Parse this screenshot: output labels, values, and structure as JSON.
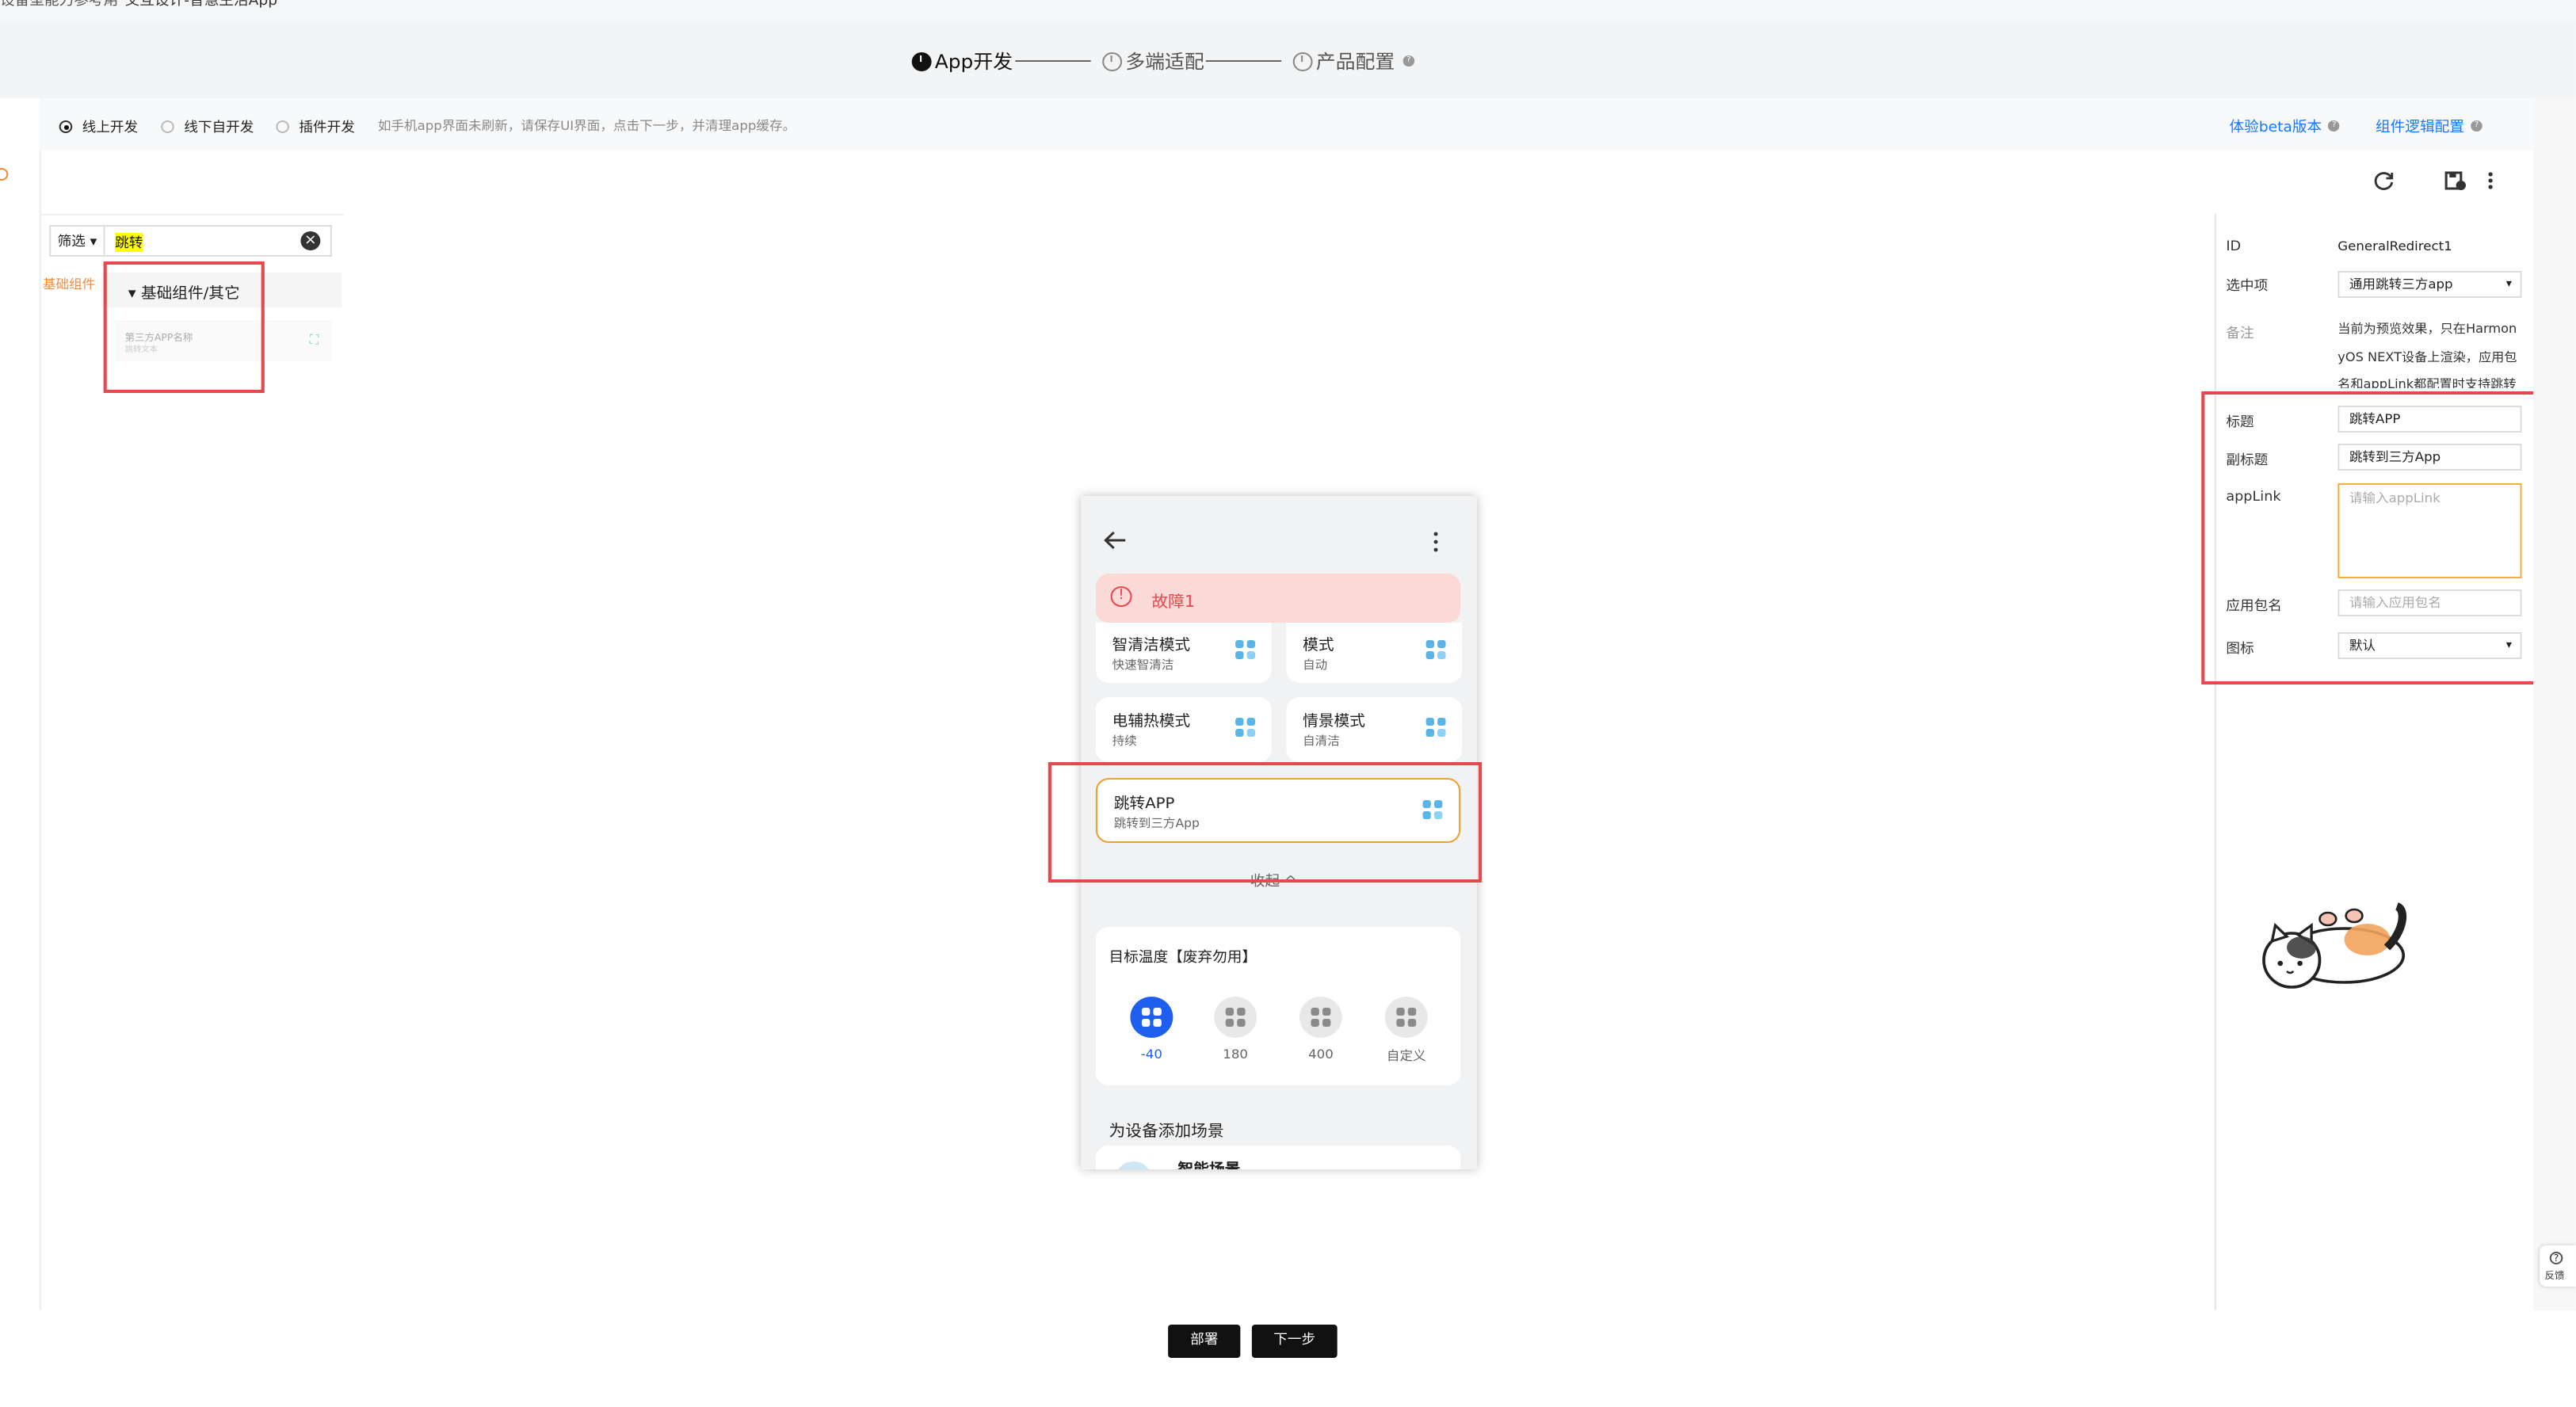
{
  "breadcrumb": {
    "parent": "设备型能力参考用",
    "current": "交互设计-智慧生活App"
  },
  "steps": [
    {
      "label": "App开发",
      "state": "active"
    },
    {
      "label": "多端适配",
      "state": "pending"
    },
    {
      "label": "产品配置",
      "state": "pending"
    }
  ],
  "mode": {
    "options": [
      "线上开发",
      "线下自开发",
      "插件开发"
    ],
    "selected": "线上开发",
    "hint": "如手机app界面未刷新，请保存UI界面，点击下一步，并清理app缓存。",
    "links": {
      "beta": "体验beta版本",
      "logic": "组件逻辑配置"
    }
  },
  "leftpanel": {
    "filter_label": "筛选",
    "search_value": "跳转",
    "side_tab": "基础组件",
    "group_label": "基础组件/其它",
    "component_title": "第三方APP名称",
    "component_sub": "跳转文本"
  },
  "phone": {
    "fault_label": "故障1",
    "cards": [
      {
        "title": "智清洁模式",
        "sub": "快速智清洁"
      },
      {
        "title": "模式",
        "sub": "自动"
      },
      {
        "title": "电辅热模式",
        "sub": "持续"
      },
      {
        "title": "情景模式",
        "sub": "自清洁"
      }
    ],
    "jump_card": {
      "title": "跳转APP",
      "sub": "跳转到三方App"
    },
    "collapse_label": "收起 ^",
    "temp_title": "目标温度【废弃勿用】",
    "temp_options": [
      "-40",
      "180",
      "400",
      "自定义"
    ],
    "scene_title": "为设备添加场景",
    "scene_item": "智能场景"
  },
  "props": {
    "id_label": "ID",
    "id_value": "GeneralRedirect1",
    "selected_label": "选中项",
    "selected_value": "通用跳转三方app",
    "note_label": "备注",
    "note_value": "当前为预览效果，只在HarmonyOS NEXT设备上渲染，应用包名和appLink都配置时支持跳转",
    "title_label": "标题",
    "title_value": "跳转APP",
    "subtitle_label": "副标题",
    "subtitle_value": "跳转到三方App",
    "applink_label": "appLink",
    "applink_placeholder": "请输入appLink",
    "pkg_label": "应用包名",
    "pkg_placeholder": "请输入应用包名",
    "icon_label": "图标",
    "icon_value": "默认"
  },
  "footer": {
    "deploy": "部署",
    "next": "下一步"
  },
  "feedback": "反馈"
}
